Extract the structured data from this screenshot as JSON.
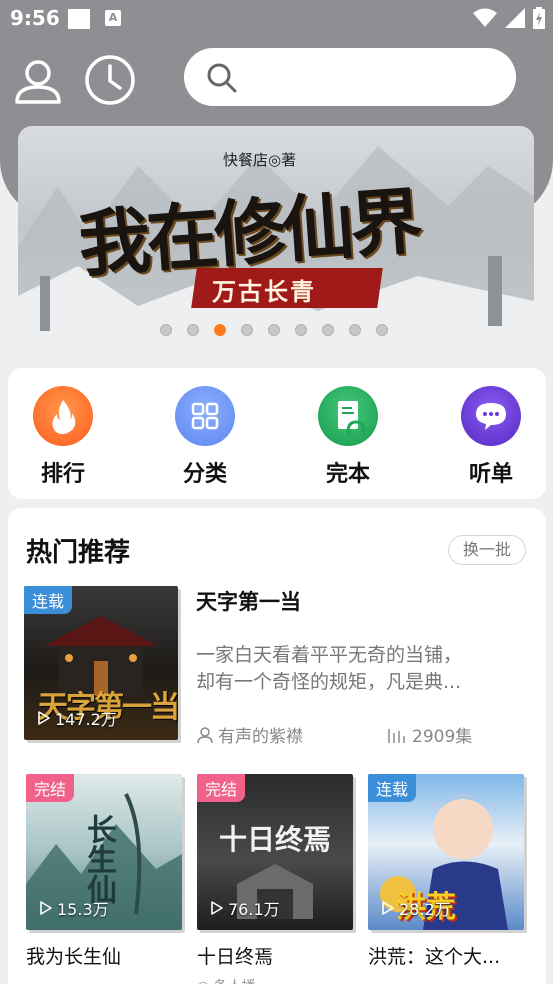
{
  "status": {
    "time": "9:56"
  },
  "header": {
    "search_placeholder": ""
  },
  "banner": {
    "author": "快餐店◎著",
    "title": "我在修仙界",
    "subtitle": "万古长青",
    "dot_count": 9,
    "active_dot": 2
  },
  "categories": [
    {
      "label": "排行",
      "icon": "flame-icon",
      "color": "#ff6a2a"
    },
    {
      "label": "分类",
      "icon": "grid-icon",
      "color": "#5b8cf5"
    },
    {
      "label": "完本",
      "icon": "book-headphone-icon",
      "color": "#1fa85a"
    },
    {
      "label": "听单",
      "icon": "chat-icon",
      "color": "#6a3ad8"
    }
  ],
  "recommend": {
    "title": "热门推荐",
    "refresh_label": "换一批",
    "featured": {
      "badge": "连载",
      "plays": "147.2万",
      "title": "天字第一当",
      "desc_line1": "一家白天看着平平无奇的当铺，",
      "desc_line2": "却有一个奇怪的规矩，凡是典...",
      "author": "有声的紫襟",
      "episodes": "2909集",
      "cover_text": "天字第一当"
    },
    "grid": [
      {
        "badge": "完结",
        "plays": "15.3万",
        "title": "我为长生仙",
        "cover_text": "长生仙"
      },
      {
        "badge": "完结",
        "plays": "76.1万",
        "title": "十日终焉",
        "cover_text": "十日终焉",
        "sub": "◎ 条人播"
      },
      {
        "badge": "连载",
        "plays": "28.2万",
        "title": "洪荒：这个大...",
        "cover_text": "洪荒"
      }
    ]
  }
}
